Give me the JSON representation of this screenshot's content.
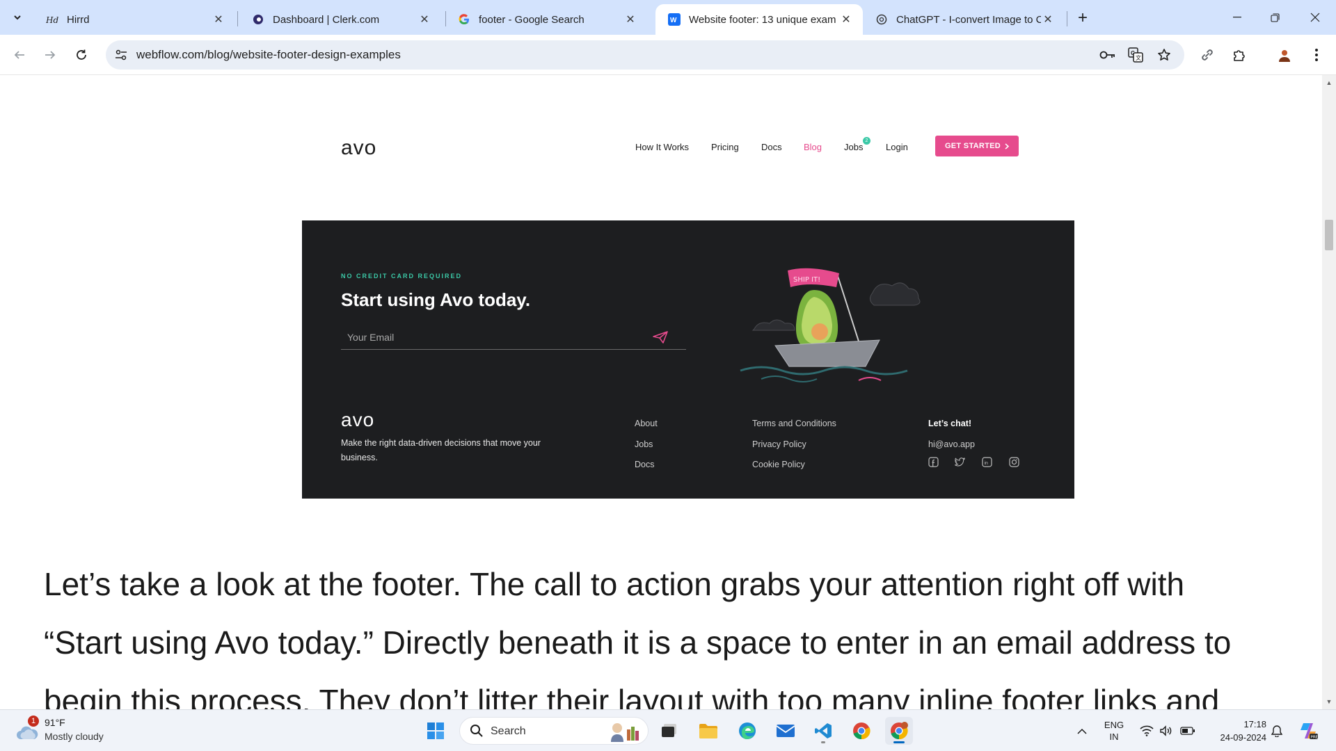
{
  "browser": {
    "tabs": [
      {
        "title": "Hirrd",
        "favicon": "hirrd-icon",
        "active": false
      },
      {
        "title": "Dashboard | Clerk.com",
        "favicon": "clerk-icon",
        "active": false
      },
      {
        "title": "footer - Google Search",
        "favicon": "google-icon",
        "active": false
      },
      {
        "title": "Website footer: 13 unique exam",
        "favicon": "webflow-icon",
        "active": true
      },
      {
        "title": "ChatGPT - I-convert Image to C",
        "favicon": "chatgpt-icon",
        "active": false
      }
    ],
    "url": "webflow.com/blog/website-footer-design-examples"
  },
  "avo_header": {
    "logo": "avo",
    "nav": [
      "How It Works",
      "Pricing",
      "Docs",
      "Blog",
      "Jobs",
      "Login"
    ],
    "jobs_badge": "2",
    "cta": "GET STARTED"
  },
  "avo_footer": {
    "tagline": "NO CREDIT CARD REQUIRED",
    "heading": "Start using Avo today.",
    "email_placeholder": "Your Email",
    "illustration_text": "SHIP IT!",
    "logo": "avo",
    "description": "Make the right data-driven decisions that move your business.",
    "col1": [
      "About",
      "Jobs",
      "Docs"
    ],
    "col2": [
      "Terms and Conditions",
      "Privacy Policy",
      "Cookie Policy"
    ],
    "contact_heading": "Let’s chat!",
    "contact_email": "hi@avo.app",
    "social": [
      "facebook-icon",
      "twitter-icon",
      "linkedin-icon",
      "instagram-icon"
    ],
    "colors": {
      "panel": "#1d1e20",
      "accent": "#e64b8d",
      "teal": "#3bc9a7"
    }
  },
  "article": {
    "lines": [
      "Let’s take a look at the footer. The call to action grabs your attention right off with",
      "“Start using Avo today.” Directly beneath it is a space to enter in an email address to",
      "begin this process. They don’t litter their layout with too many inline footer links and"
    ]
  },
  "taskbar": {
    "weather_temp": "91°F",
    "weather_cond": "Mostly cloudy",
    "weather_badge": "1",
    "search": "Search",
    "lang_top": "ENG",
    "lang_bottom": "IN",
    "time": "17:18",
    "date": "24-09-2024"
  }
}
